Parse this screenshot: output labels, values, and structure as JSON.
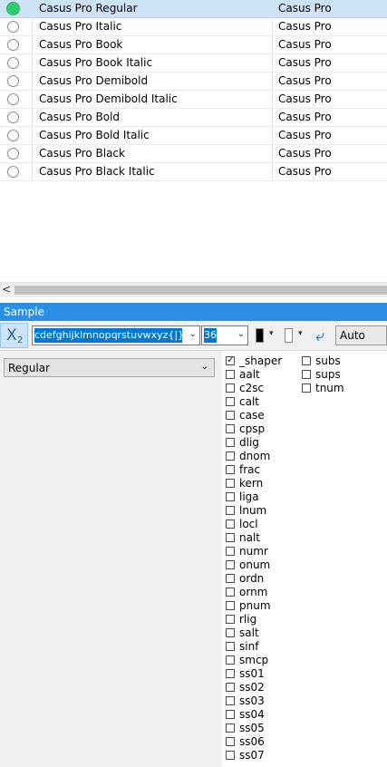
{
  "fonts": [
    {
      "name": "Casus Pro Regular",
      "family": "Casus Pro",
      "selected": true
    },
    {
      "name": "Casus Pro Italic",
      "family": "Casus Pro",
      "selected": false
    },
    {
      "name": "Casus Pro Book",
      "family": "Casus Pro",
      "selected": false
    },
    {
      "name": "Casus Pro Book Italic",
      "family": "Casus Pro",
      "selected": false
    },
    {
      "name": "Casus Pro Demibold",
      "family": "Casus Pro",
      "selected": false
    },
    {
      "name": "Casus Pro Demibold Italic",
      "family": "Casus Pro",
      "selected": false
    },
    {
      "name": "Casus Pro Bold",
      "family": "Casus Pro",
      "selected": false
    },
    {
      "name": "Casus Pro Bold Italic",
      "family": "Casus Pro",
      "selected": false
    },
    {
      "name": "Casus Pro Black",
      "family": "Casus Pro",
      "selected": false
    },
    {
      "name": "Casus Pro Black Italic",
      "family": "Casus Pro",
      "selected": false
    }
  ],
  "scroll_left_glyph": "<",
  "sample": {
    "title": "Sample",
    "subscript_button": {
      "main": "X",
      "sub": "2"
    },
    "text_value": "cdefghijklmnopqrstuvwxyz{|}~",
    "size_value": "36",
    "fg_color": "#000000",
    "bg_color": "#ffffff",
    "direction_value": "Auto",
    "style_value": "Regular",
    "icons": {
      "swap": "swap-arrow-icon",
      "dropdown": "chevron-down-icon"
    }
  },
  "features": [
    {
      "tag": "_shaper",
      "checked": true
    },
    {
      "tag": "aalt",
      "checked": false
    },
    {
      "tag": "c2sc",
      "checked": false
    },
    {
      "tag": "calt",
      "checked": false
    },
    {
      "tag": "case",
      "checked": false
    },
    {
      "tag": "cpsp",
      "checked": false
    },
    {
      "tag": "dlig",
      "checked": false
    },
    {
      "tag": "dnom",
      "checked": false
    },
    {
      "tag": "frac",
      "checked": false
    },
    {
      "tag": "kern",
      "checked": false
    },
    {
      "tag": "liga",
      "checked": false
    },
    {
      "tag": "lnum",
      "checked": false
    },
    {
      "tag": "locl",
      "checked": false
    },
    {
      "tag": "nalt",
      "checked": false
    },
    {
      "tag": "numr",
      "checked": false
    },
    {
      "tag": "onum",
      "checked": false
    },
    {
      "tag": "ordn",
      "checked": false
    },
    {
      "tag": "ornm",
      "checked": false
    },
    {
      "tag": "pnum",
      "checked": false
    },
    {
      "tag": "rlig",
      "checked": false
    },
    {
      "tag": "salt",
      "checked": false
    },
    {
      "tag": "sinf",
      "checked": false
    },
    {
      "tag": "smcp",
      "checked": false
    },
    {
      "tag": "ss01",
      "checked": false
    },
    {
      "tag": "ss02",
      "checked": false
    },
    {
      "tag": "ss03",
      "checked": false
    },
    {
      "tag": "ss04",
      "checked": false
    },
    {
      "tag": "ss05",
      "checked": false
    },
    {
      "tag": "ss06",
      "checked": false
    },
    {
      "tag": "ss07",
      "checked": false
    },
    {
      "tag": "subs",
      "checked": false
    },
    {
      "tag": "sups",
      "checked": false
    },
    {
      "tag": "tnum",
      "checked": false
    }
  ]
}
